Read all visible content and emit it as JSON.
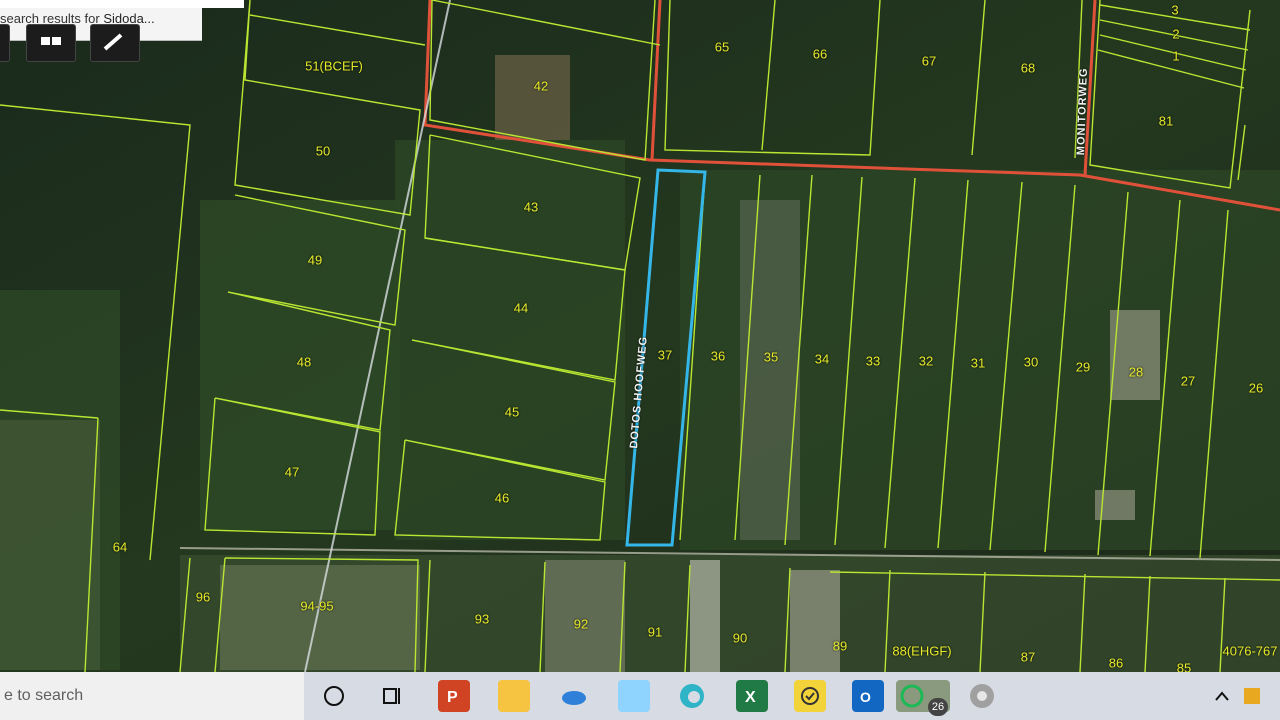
{
  "app": {
    "search_results_prefix": "search results for ",
    "search_results_term": "Sidoda..."
  },
  "map": {
    "plots": [
      "42",
      "43",
      "44",
      "45",
      "46",
      "47",
      "48",
      "49",
      "50",
      "51(BCEF)",
      "65",
      "66",
      "67",
      "68",
      "81",
      "3",
      "2",
      "1",
      "37",
      "36",
      "35",
      "34",
      "33",
      "32",
      "31",
      "30",
      "29",
      "28",
      "27",
      "26",
      "64",
      "96",
      "94-95",
      "93",
      "92",
      "91",
      "90",
      "89",
      "88(EHGF)",
      "87",
      "86",
      "85",
      "4076-767"
    ],
    "streets": [
      "DOTOS HOOFWEG",
      "MONITORWEG"
    ]
  },
  "taskbar": {
    "search_placeholder": "e to search",
    "chat_badge": "26",
    "icons": [
      "cortana-icon",
      "task-view-icon",
      "powerpoint-icon",
      "file-explorer-icon",
      "onedrive-icon",
      "notes-icon",
      "edge-icon",
      "excel-icon",
      "todo-icon",
      "outlook-icon",
      "whatsapp-icon",
      "chrome-icon",
      "chevron-up-icon",
      "tray-app-icon"
    ]
  },
  "colors": {
    "boundary": "#b9e632",
    "selected": "#34b7e8",
    "road": "#e0513a",
    "label": "#e6ea2a"
  }
}
